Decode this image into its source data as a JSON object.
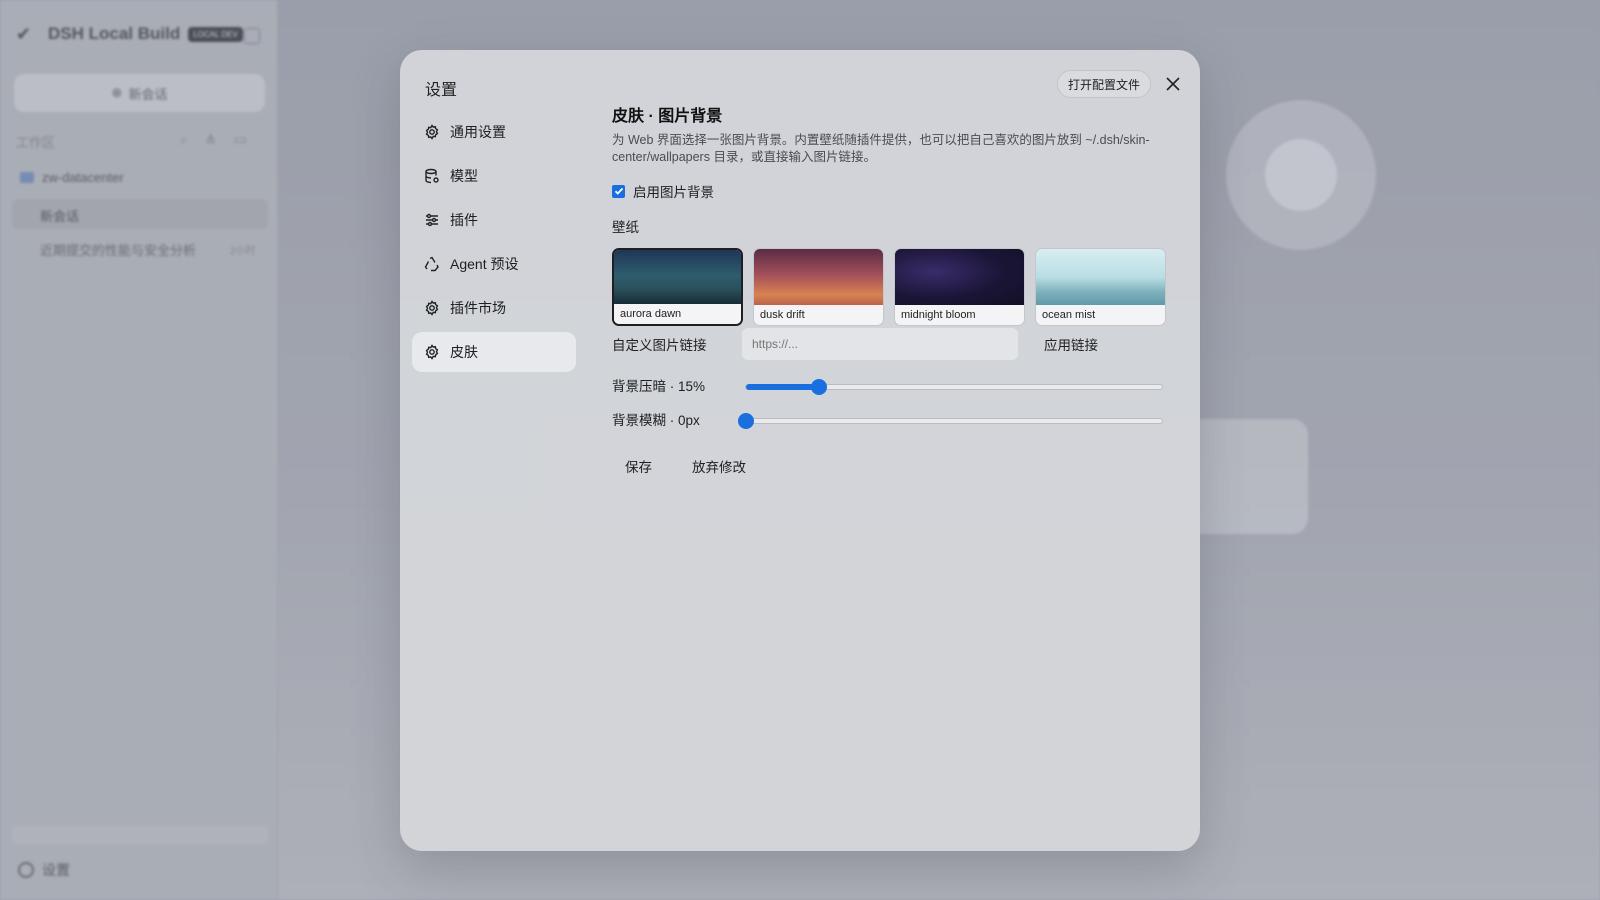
{
  "background_app": {
    "logo_text": "DSH Local Build",
    "badge": "LOCAL DEV",
    "new_chat": "新会话",
    "workspace_label": "工作区",
    "folder": "zw-datacenter",
    "active_chat": "新会话",
    "chat_item": "近期提交的性能与安全分析",
    "chat_time": "2小时",
    "settings": "设置"
  },
  "modal": {
    "title": "设置",
    "open_config": "打开配置文件",
    "nav": [
      {
        "label": "通用设置",
        "icon": "gear-icon"
      },
      {
        "label": "模型",
        "icon": "database-icon"
      },
      {
        "label": "插件",
        "icon": "sliders-icon"
      },
      {
        "label": "Agent 预设",
        "icon": "recycle-icon"
      },
      {
        "label": "插件市场",
        "icon": "gear-icon"
      },
      {
        "label": "皮肤",
        "icon": "gear-icon"
      }
    ],
    "active_nav": "皮肤"
  },
  "skin": {
    "title": "皮肤 · 图片背景",
    "description": "为 Web 界面选择一张图片背景。内置壁纸随插件提供，也可以把自己喜欢的图片放到 ~/.dsh/skin-center/wallpapers 目录，或直接输入图片链接。",
    "enable_label": "启用图片背景",
    "enabled": true,
    "wallpaper_label": "壁纸",
    "wallpapers": [
      {
        "name": "aurora dawn",
        "selected": true
      },
      {
        "name": "dusk drift",
        "selected": false
      },
      {
        "name": "midnight bloom",
        "selected": false
      },
      {
        "name": "ocean mist",
        "selected": false
      }
    ],
    "custom_label": "自定义图片链接",
    "custom_placeholder": "https://...",
    "apply_label": "应用链接",
    "dim_label": "背景压暗 · 15%",
    "dim_value": 0.15,
    "blur_label": "背景模糊 · 0px",
    "blur_value": 0,
    "save_label": "保存",
    "discard_label": "放弃修改"
  },
  "colors": {
    "accent": "#1a6fe0",
    "modal_bg": "#d3d5da",
    "active_nav_bg": "#e8e9ec"
  }
}
